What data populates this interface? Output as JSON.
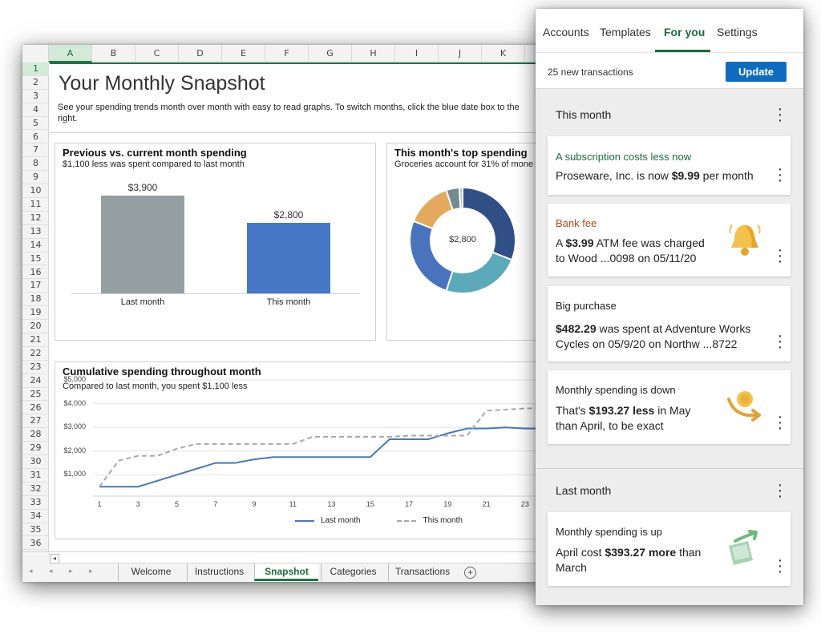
{
  "excel": {
    "columns": [
      "A",
      "B",
      "C",
      "D",
      "E",
      "F",
      "G",
      "H",
      "I",
      "J",
      "K"
    ],
    "selected_column": "A",
    "rows": [
      "1",
      "2",
      "3",
      "4",
      "5",
      "6",
      "7",
      "8",
      "9",
      "10",
      "11",
      "12",
      "13",
      "14",
      "15",
      "16",
      "17",
      "18",
      "19",
      "20",
      "21",
      "22",
      "23",
      "24",
      "25",
      "26",
      "27",
      "28",
      "29",
      "30",
      "31",
      "32",
      "33",
      "34",
      "35",
      "36"
    ],
    "selected_row": "1",
    "title": "Your Monthly Snapshot",
    "description": "See your spending trends month over month with easy to read graphs. To switch months, click the blue date box to the right.",
    "prev_vs_current": {
      "title": "Previous vs. current month spending",
      "subtitle": "$1,100 less was spent compared to last month"
    },
    "top_spending": {
      "title": "This month's top spending",
      "subtitle": "Groceries account for 31% of mone",
      "center_label": "$2,800"
    },
    "cumulative": {
      "title": "Cumulative spending throughout month",
      "subtitle": "Compared to last month, you spent $1,100 less",
      "legend_last": "Last month",
      "legend_this": "This month"
    },
    "sheet_tabs": [
      "Welcome",
      "Instructions",
      "Snapshot",
      "Categories",
      "Transactions"
    ],
    "active_tab": "Snapshot",
    "add_sheet_icon": "plus-circle-icon",
    "nav_arrows": "◂ ◂ ▸ ▸",
    "scroll_arrow": "◂"
  },
  "chart_data": [
    {
      "type": "bar",
      "categories": [
        "Last month",
        "This month"
      ],
      "values": [
        3900,
        2800
      ],
      "data_labels": [
        "$3,900",
        "$2,800"
      ],
      "colors": [
        "#959fa1",
        "#4778c8"
      ],
      "title": "Previous vs. current month spending",
      "subtitle": "$1,100 less was spent compared to last month"
    },
    {
      "type": "pie",
      "title": "This month's top spending",
      "subtitle": "Groceries account for 31% of mone",
      "center_label": "$2,800",
      "slices": [
        {
          "value": 31,
          "color": "#2f4f86"
        },
        {
          "value": 24,
          "color": "#5ba9b9"
        },
        {
          "value": 26,
          "color": "#4a73bd"
        },
        {
          "value": 14,
          "color": "#e3aa5f"
        },
        {
          "value": 4,
          "color": "#758a8e"
        },
        {
          "value": 1,
          "color": "#b8bfbf"
        }
      ]
    },
    {
      "type": "line",
      "title": "Cumulative spending throughout month",
      "subtitle": "Compared to last month, you spent $1,100 less",
      "x": [
        1,
        3,
        5,
        7,
        9,
        11,
        13,
        15,
        17,
        19,
        21,
        23
      ],
      "ylim": [
        0,
        5000
      ],
      "yticks": [
        "$1,000",
        "$2,000",
        "$3,000",
        "$4,000",
        "$5,000"
      ],
      "ytick_values": [
        1000,
        2000,
        3000,
        4000,
        5000
      ],
      "series": [
        {
          "name": "Last month",
          "style": "solid",
          "color": "#4a78b5",
          "points": [
            [
              1,
              500
            ],
            [
              2,
              500
            ],
            [
              3,
              500
            ],
            [
              4,
              750
            ],
            [
              5,
              1000
            ],
            [
              6,
              1250
            ],
            [
              7,
              1500
            ],
            [
              8,
              1500
            ],
            [
              9,
              1650
            ],
            [
              10,
              1750
            ],
            [
              11,
              1750
            ],
            [
              12,
              1750
            ],
            [
              13,
              1750
            ],
            [
              14,
              1750
            ],
            [
              15,
              1750
            ],
            [
              16,
              2500
            ],
            [
              17,
              2500
            ],
            [
              18,
              2500
            ],
            [
              19,
              2750
            ],
            [
              20,
              2950
            ],
            [
              21,
              2950
            ],
            [
              22,
              3000
            ],
            [
              23,
              2950
            ],
            [
              24,
              2950
            ]
          ]
        },
        {
          "name": "This month",
          "style": "dashed",
          "color": "#a9a9a9",
          "points": [
            [
              1,
              500
            ],
            [
              2,
              1600
            ],
            [
              3,
              1800
            ],
            [
              4,
              1800
            ],
            [
              5,
              2100
            ],
            [
              6,
              2300
            ],
            [
              7,
              2300
            ],
            [
              8,
              2300
            ],
            [
              9,
              2300
            ],
            [
              10,
              2300
            ],
            [
              11,
              2300
            ],
            [
              12,
              2600
            ],
            [
              13,
              2600
            ],
            [
              14,
              2600
            ],
            [
              15,
              2600
            ],
            [
              16,
              2600
            ],
            [
              17,
              2650
            ],
            [
              18,
              2650
            ],
            [
              19,
              2650
            ],
            [
              20,
              2650
            ],
            [
              21,
              3700
            ],
            [
              22,
              3750
            ],
            [
              23,
              3800
            ],
            [
              24,
              3800
            ]
          ]
        }
      ]
    }
  ],
  "pane": {
    "tabs": [
      "Accounts",
      "Templates",
      "For you",
      "Settings"
    ],
    "active_tab": "For you",
    "new_transactions": "25 new transactions",
    "update_label": "Update",
    "this_month_label": "This month",
    "last_month_label": "Last month",
    "cards": [
      {
        "title": "A subscription costs less now",
        "title_color": "green",
        "line1_pre": "Proseware, Inc. is now ",
        "line1_bold": "$9.99",
        "line1_post": " per month",
        "line2_pre": "",
        "line2_bold": "",
        "line2_post": "",
        "icon": ""
      },
      {
        "title": "Bank fee",
        "title_color": "orange",
        "line1_pre": "A ",
        "line1_bold": "$3.99",
        "line1_post": " ATM fee was charged",
        "line2_pre": "to Wood ...0098 on 05/11/20",
        "line2_bold": "",
        "line2_post": "",
        "icon": "bell-icon"
      },
      {
        "title": "Big purchase",
        "title_color": "dark",
        "line1_pre": "",
        "line1_bold": "$482.29",
        "line1_post": " was spent at Adventure Works",
        "line2_pre": "Cycles on 05/9/20 on Northw ...8722",
        "line2_bold": "",
        "line2_post": "",
        "icon": ""
      },
      {
        "title": "Monthly spending is down",
        "title_color": "dark",
        "line1_pre": "That's ",
        "line1_bold": "$193.27 less",
        "line1_post": " in May",
        "line2_pre": "than April, to be exact",
        "line2_bold": "",
        "line2_post": "",
        "icon": "falling-coin-icon"
      },
      {
        "title": "Monthly spending is up",
        "title_color": "dark",
        "line1_pre": "April cost ",
        "line1_bold": "$393.27 more",
        "line1_post": " than",
        "line2_pre": "March",
        "line2_bold": "",
        "line2_post": "",
        "icon": "rising-money-icon"
      }
    ]
  }
}
